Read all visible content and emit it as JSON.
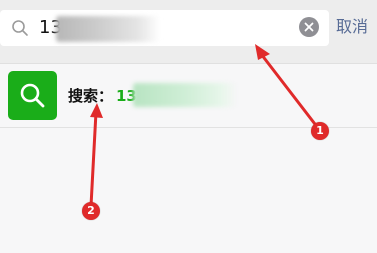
{
  "search": {
    "query": "13",
    "cancel_label": "取消",
    "icon": "search-icon",
    "clear_icon": "clear-icon"
  },
  "result": {
    "label": "搜索：",
    "number": "13",
    "icon": "search-icon"
  },
  "annotations": [
    {
      "number": "1"
    },
    {
      "number": "2"
    }
  ],
  "colors": {
    "accent_green": "#1aad19",
    "link_blue": "#576b95",
    "annotation_red": "#e02a2a"
  }
}
